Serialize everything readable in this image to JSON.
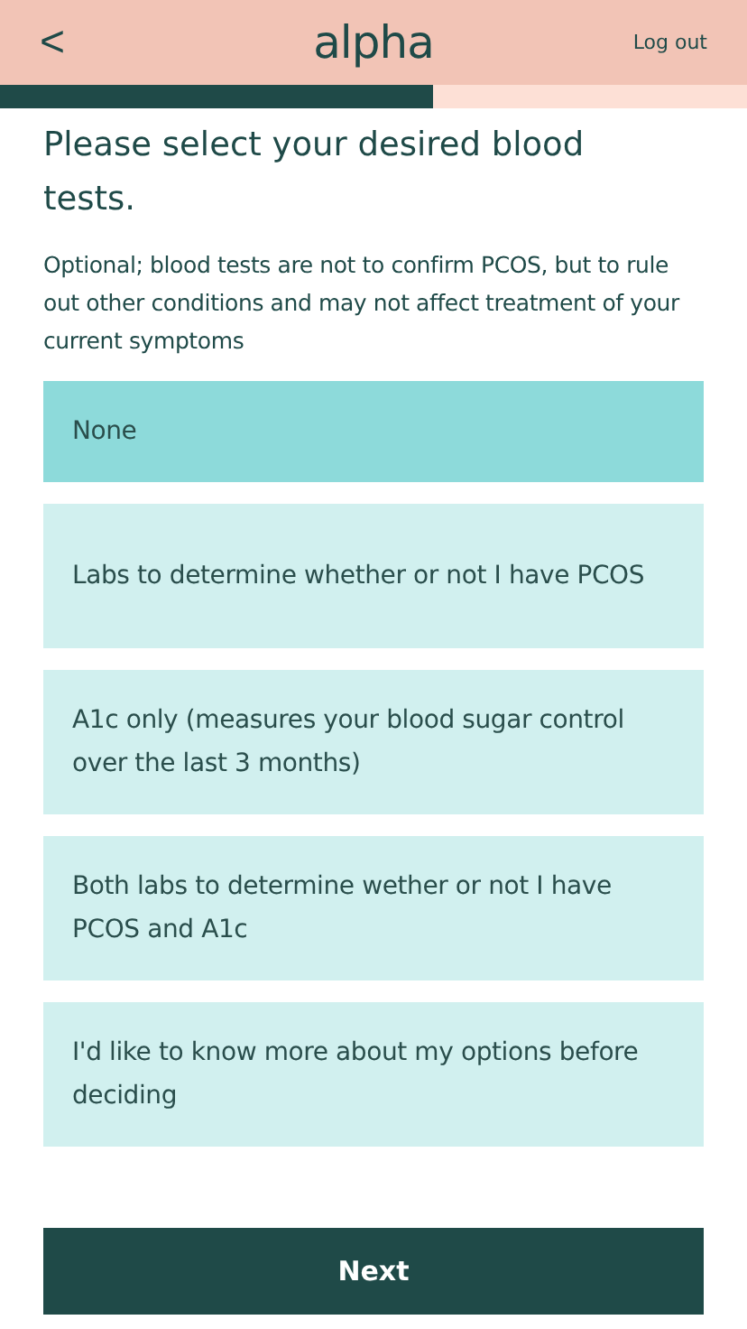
{
  "header": {
    "back": "<",
    "logo": "alpha",
    "logout": "Log out"
  },
  "progress": {
    "level": 0.58
  },
  "title": "Please select your desired blood tests.",
  "subtitle": "Optional; blood tests are not to confirm PCOS, but to rule out other conditions and may not affect treatment of your current symptoms",
  "options": [
    {
      "label": "None",
      "selected": true
    },
    {
      "label": "Labs to determine whether or not I have PCOS",
      "selected": false
    },
    {
      "label": "A1c only (measures your blood sugar control over the last 3 months)",
      "selected": false
    },
    {
      "label": "Both labs to determine wether or not I have PCOS and A1c",
      "selected": false
    },
    {
      "label": "I'd like to know more about my options before deciding",
      "selected": false
    }
  ],
  "next_button": "Next"
}
